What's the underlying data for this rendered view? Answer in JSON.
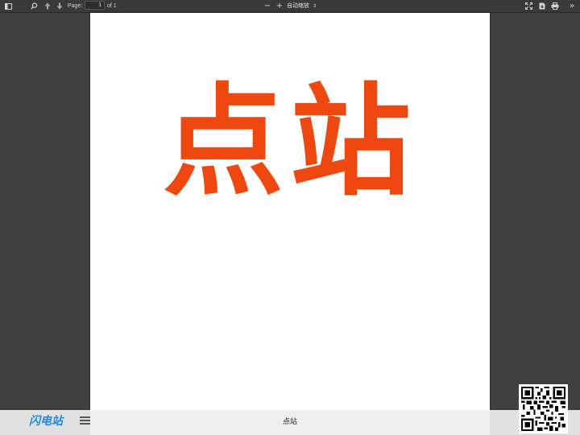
{
  "toolbar": {
    "page_label": "Page:",
    "page_value": "1",
    "page_total": "of 1",
    "zoom_out_glyph": "−",
    "zoom_in_glyph": "+",
    "zoom_value": "自动缩放",
    "icons": [
      "sidebar-toggle-icon",
      "search-icon",
      "previous-page-icon",
      "next-page-icon",
      "zoom-out-icon",
      "zoom-in-icon",
      "presentation-mode-icon",
      "download-icon",
      "print-icon",
      "tools-icon"
    ]
  },
  "document": {
    "heading": "点站"
  },
  "bottom_bar": {
    "brand": "闪电站",
    "title": "点站",
    "icons": [
      "menu-icon",
      "qr-code-icon"
    ]
  },
  "colors": {
    "toolbar_bg": "#3a3a3a",
    "viewer_bg": "#404040",
    "page_bg": "#ffffff",
    "heading": "#ee4810",
    "brand": "#1e88e5"
  }
}
